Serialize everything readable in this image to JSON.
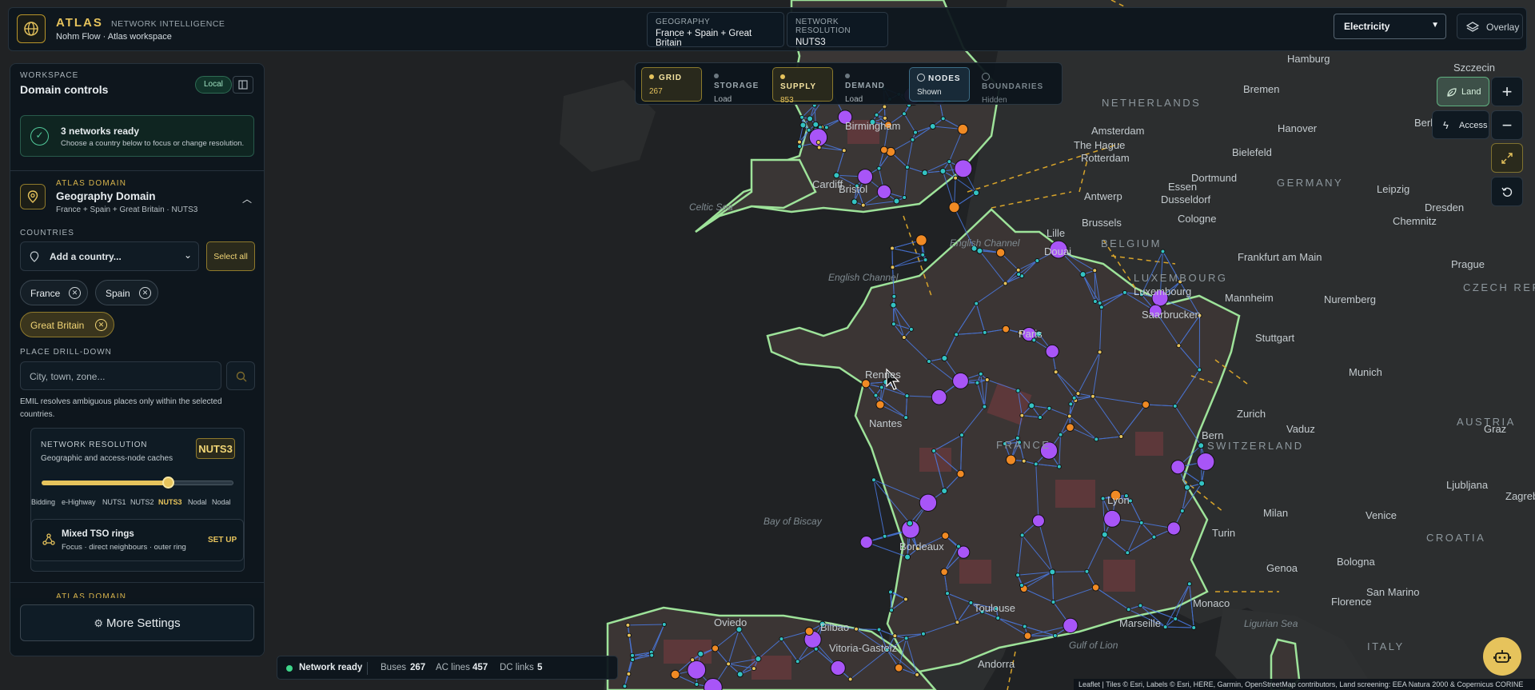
{
  "app": {
    "brand": "ATLAS",
    "brand_sub": "NETWORK INTELLIGENCE",
    "workspace_line": "Nohm Flow · Atlas workspace"
  },
  "header": {
    "geography_label": "GEOGRAPHY",
    "geography_value": "France + Spain + Great Britain",
    "resolution_label": "NETWORK RESOLUTION",
    "resolution_value": "NUTS3",
    "commodity_select": "Electricity",
    "overlay_label": "Overlay"
  },
  "sidebar": {
    "workspace_kicker": "WORKSPACE",
    "title": "Domain controls",
    "local_badge": "Local",
    "ready_title": "3 networks ready",
    "ready_sub": "Choose a country below to focus or change resolution.",
    "domain_kicker": "ATLAS DOMAIN",
    "domain_title": "Geography Domain",
    "domain_sub": "France + Spain + Great Britain · NUTS3",
    "countries_label": "COUNTRIES",
    "add_country_placeholder": "Add a country...",
    "select_all": "Select all",
    "chips": [
      "France",
      "Spain",
      "Great Britain"
    ],
    "drill_label": "PLACE DRILL-DOWN",
    "drill_placeholder": "City, town, zone...",
    "drill_note": "EMIL resolves ambiguous places only within the selected countries.",
    "resolution_title": "NETWORK RESOLUTION",
    "resolution_sub": "Geographic and access-node caches",
    "resolution_badge": "NUTS3",
    "resolution_level": 0.66,
    "resolution_ticks": [
      "Bidding",
      "e-Highway",
      "NUTS1",
      "NUTS2",
      "NUTS3",
      "Nodal",
      "Nodal"
    ],
    "tso_title": "Mixed TSO rings",
    "tso_sub": "Focus · direct neighbours · outer ring",
    "tso_action": "SET UP",
    "next_domain_kicker": "ATLAS DOMAIN",
    "more_settings": "More Settings"
  },
  "layers": [
    {
      "name": "GRID",
      "detail": "267",
      "state": "active",
      "dot": "#e6c35c"
    },
    {
      "name": "STORAGE",
      "detail": "Load",
      "state": "idle",
      "dot": "#6c7880"
    },
    {
      "name": "SUPPLY",
      "detail": "853",
      "state": "active",
      "dot": "#e6c35c"
    },
    {
      "name": "DEMAND",
      "detail": "Load",
      "state": "idle",
      "dot": "#6c7880"
    },
    {
      "name": "NODES",
      "detail": "Shown",
      "state": "on",
      "dot": "#5fc0d8"
    },
    {
      "name": "BOUNDARIES",
      "detail": "Hidden",
      "state": "off",
      "dot": "#6c7880"
    }
  ],
  "map_controls": {
    "land_label": "Land",
    "access_label": "Access",
    "zoom_in": "+",
    "zoom_out": "−"
  },
  "status": {
    "state": "Network ready",
    "buses_label": "Buses",
    "buses": "267",
    "ac_label": "AC lines",
    "ac": "457",
    "dc_label": "DC links",
    "dc": "5"
  },
  "attribution": "Leaflet | Tiles © Esri, Labels © Esri, HERE, Garmin, OpenStreetMap contributors, Land screening: EEA Natura 2000 & Copernicus CORINE",
  "map_labels": {
    "cities": [
      "Hamburg",
      "Szczecin",
      "Bremen",
      "Amsterdam",
      "The Hague",
      "Rotterdam",
      "Hanover",
      "Bielefeld",
      "Dortmund",
      "Essen",
      "Dusseldorf",
      "Leipzig",
      "Dresden",
      "Chemnitz",
      "Antwerp",
      "Brussels",
      "Cologne",
      "Frankfurt am Main",
      "Prague",
      "Lille",
      "Douai",
      "Luxembourg",
      "Mannheim",
      "Nuremberg",
      "Saarbrucken",
      "Stuttgart",
      "Munich",
      "Zurich",
      "Vaduz",
      "Bern",
      "Graz",
      "Ljubljana",
      "Zagreb",
      "Milan",
      "Venice",
      "Turin",
      "Genoa",
      "Bologna",
      "San Marino",
      "Florence",
      "Monaco",
      "Lyon",
      "Marseille",
      "Toulouse",
      "Andorra",
      "Bordeaux",
      "Nantes",
      "Rennes",
      "Paris",
      "Birmingham",
      "Bristol",
      "Cardiff",
      "Bilbao",
      "Vitoria-Gasteiz",
      "Oviedo",
      "Berlin"
    ],
    "countries": [
      "GERMANY",
      "NETHERLANDS",
      "BELGIUM",
      "LUXEMBOURG",
      "FRANCE",
      "SWITZERLAND",
      "AUSTRIA",
      "CZECH REPUBLIC",
      "CROATIA",
      "ITALY"
    ],
    "seas": [
      "Celtic Sea",
      "English Channel",
      "Bay of Biscay",
      "Gulf of Lion",
      "Ligurian Sea"
    ]
  },
  "colors": {
    "gold": "#e6c35c",
    "node_purple": "#a855f7",
    "node_cyan": "#33c3c3",
    "node_orange": "#f08a24",
    "line_blue": "#4c7ff0",
    "border_green": "#9ee39a"
  }
}
